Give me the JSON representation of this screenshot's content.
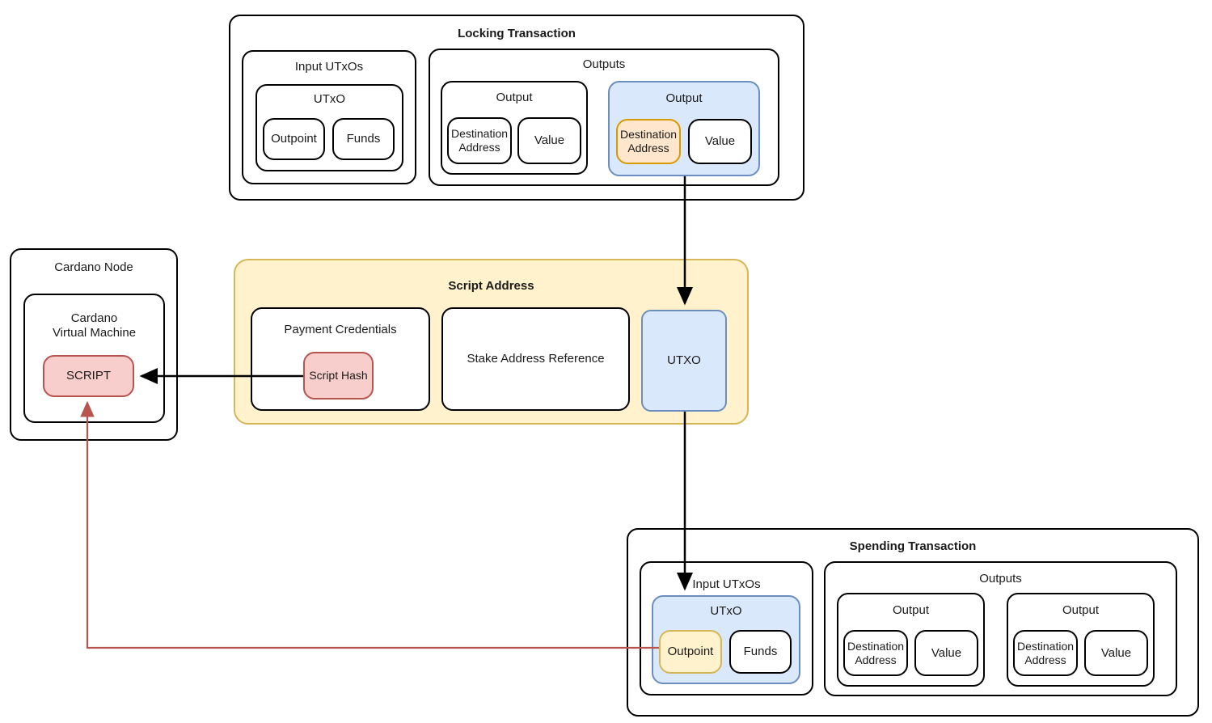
{
  "diagram": {
    "title_locking": "Locking Transaction",
    "title_spending": "Spending Transaction",
    "title_script_address": "Script Address",
    "title_cardano_node": "Cardano Node",
    "label_cvm": "Cardano\nVirtual Machine",
    "label_script": "SCRIPT",
    "label_script_hash": "Script Hash",
    "label_payment_credentials": "Payment Credentials",
    "label_stake_address_reference": "Stake Address Reference",
    "label_utxo_script_addr": "UTXO",
    "label_input_utxos": "Input UTxOs",
    "label_outputs": "Outputs",
    "label_utxo": "UTxO",
    "label_outpoint": "Outpoint",
    "label_funds": "Funds",
    "label_output": "Output",
    "label_destination_address": "Destination\nAddress",
    "label_value": "Value"
  },
  "locking_transaction": {
    "title": "Locking Transaction",
    "input_utxos": {
      "label": "Input UTxOs",
      "utxos": [
        {
          "label": "UTxO",
          "fields": [
            "Outpoint",
            "Funds"
          ]
        }
      ]
    },
    "outputs": {
      "label": "Outputs",
      "items": [
        {
          "label": "Output",
          "highlighted": false,
          "fields": [
            "Destination\nAddress",
            "Value"
          ]
        },
        {
          "label": "Output",
          "highlighted": true,
          "fields": [
            "Destination\nAddress",
            "Value"
          ]
        }
      ]
    }
  },
  "script_address": {
    "title": "Script Address",
    "payment_credentials": {
      "label": "Payment Credentials",
      "script_hash": "Script Hash"
    },
    "stake_address_reference": "Stake Address Reference",
    "utxo": "UTXO"
  },
  "cardano_node": {
    "title": "Cardano Node",
    "virtual_machine": "Cardano\nVirtual Machine",
    "script": "SCRIPT"
  },
  "spending_transaction": {
    "title": "Spending Transaction",
    "input_utxos": {
      "label": "Input UTxOs",
      "utxos": [
        {
          "label": "UTxO",
          "highlighted": true,
          "fields": [
            "Outpoint",
            "Funds"
          ]
        }
      ]
    },
    "outputs": {
      "label": "Outputs",
      "items": [
        {
          "label": "Output",
          "fields": [
            "Destination\nAddress",
            "Value"
          ]
        },
        {
          "label": "Output",
          "fields": [
            "Destination\nAddress",
            "Value"
          ]
        }
      ]
    }
  },
  "colors": {
    "blue_fill": "#dae8fc",
    "blue_stroke": "#6c8ebf",
    "orange_fill": "#ffe6cc",
    "orange_stroke": "#d79b00",
    "yellow_fill": "#fff2cc",
    "yellow_stroke": "#d6b656",
    "red_fill": "#f8cecc",
    "red_stroke": "#b85450",
    "arrow_black": "#000000",
    "arrow_red": "#b85450"
  }
}
